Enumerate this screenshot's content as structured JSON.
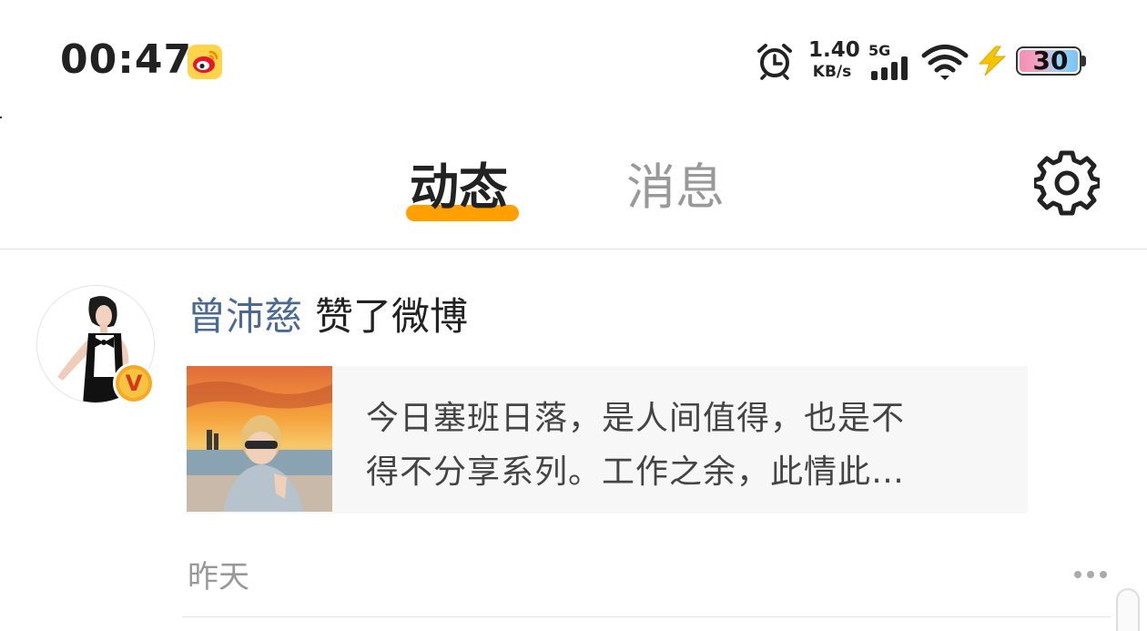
{
  "status_bar": {
    "time": "00:47",
    "app_icon": "weibo-icon",
    "alarm_icon": "alarm-clock-icon",
    "net_speed_value": "1.40",
    "net_speed_unit": "KB/s",
    "network_type": "5G",
    "battery_level": "30",
    "colors": {
      "battery_fill_left": "#f58fb2",
      "battery_fill_right": "#7cc3f5",
      "charge_bolt": "#f5c400"
    }
  },
  "header": {
    "tabs": [
      {
        "label": "动态",
        "active": true
      },
      {
        "label": "消息",
        "active": false
      }
    ],
    "settings_icon": "gear-icon",
    "accent_color": "#ff9f00"
  },
  "feed": {
    "items": [
      {
        "user_name": "曾沛慈",
        "action": "赞了微博",
        "verified": true,
        "card_lines": [
          "今日塞班日落，是人间值得，也是不",
          "得不分享系列。工作之余，此情此…"
        ],
        "timestamp": "昨天",
        "more_icon": "more-icon"
      }
    ],
    "colors": {
      "user_name": "#4a6a94",
      "card_bg": "#f7f7f7",
      "meta_text": "#999999"
    }
  }
}
